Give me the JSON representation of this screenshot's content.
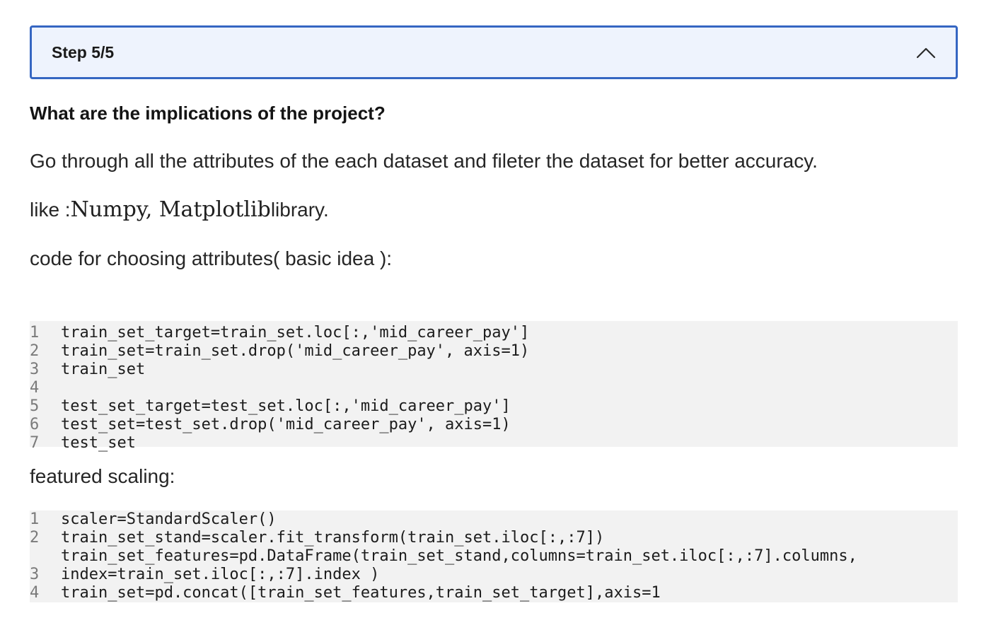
{
  "step": {
    "title": "Step 5/5",
    "chevron_icon": "chevron-up-icon"
  },
  "question": "What are the implications of the project?",
  "paragraphs": {
    "p1": "Go through all the attributes of the each dataset and fileter the dataset for better accuracy.",
    "p2_prefix": "like :",
    "p2_math": "Numpy, Matplotlib",
    "p2_suffix": "library.",
    "p3": "code for choosing attributes( basic idea ):",
    "p4": "featured scaling:"
  },
  "code_block_1": {
    "lines": [
      {
        "num": "1",
        "text": "train_set_target=train_set.loc[:,'mid_career_pay']"
      },
      {
        "num": "2",
        "text": "train_set=train_set.drop('mid_career_pay', axis=1)"
      },
      {
        "num": "3",
        "text": "train_set"
      },
      {
        "num": "4",
        "text": ""
      },
      {
        "num": "5",
        "text": "test_set_target=test_set.loc[:,'mid_career_pay']"
      },
      {
        "num": "6",
        "text": "test_set=test_set.drop('mid_career_pay', axis=1)"
      },
      {
        "num": "7",
        "text": "test_set"
      }
    ]
  },
  "code_block_2": {
    "lines": [
      {
        "num": "1",
        "text": "scaler=StandardScaler()"
      },
      {
        "num": "2",
        "text": "train_set_stand=scaler.fit_transform(train_set.iloc[:,:7])"
      },
      {
        "num": "",
        "text": "train_set_features=pd.DataFrame(train_set_stand,columns=train_set.iloc[:,:7].columns,"
      },
      {
        "num": "3",
        "text": "index=train_set.iloc[:,:7].index )"
      },
      {
        "num": "4",
        "text": "train_set=pd.concat([train_set_features,train_set_target],axis=1"
      }
    ]
  }
}
